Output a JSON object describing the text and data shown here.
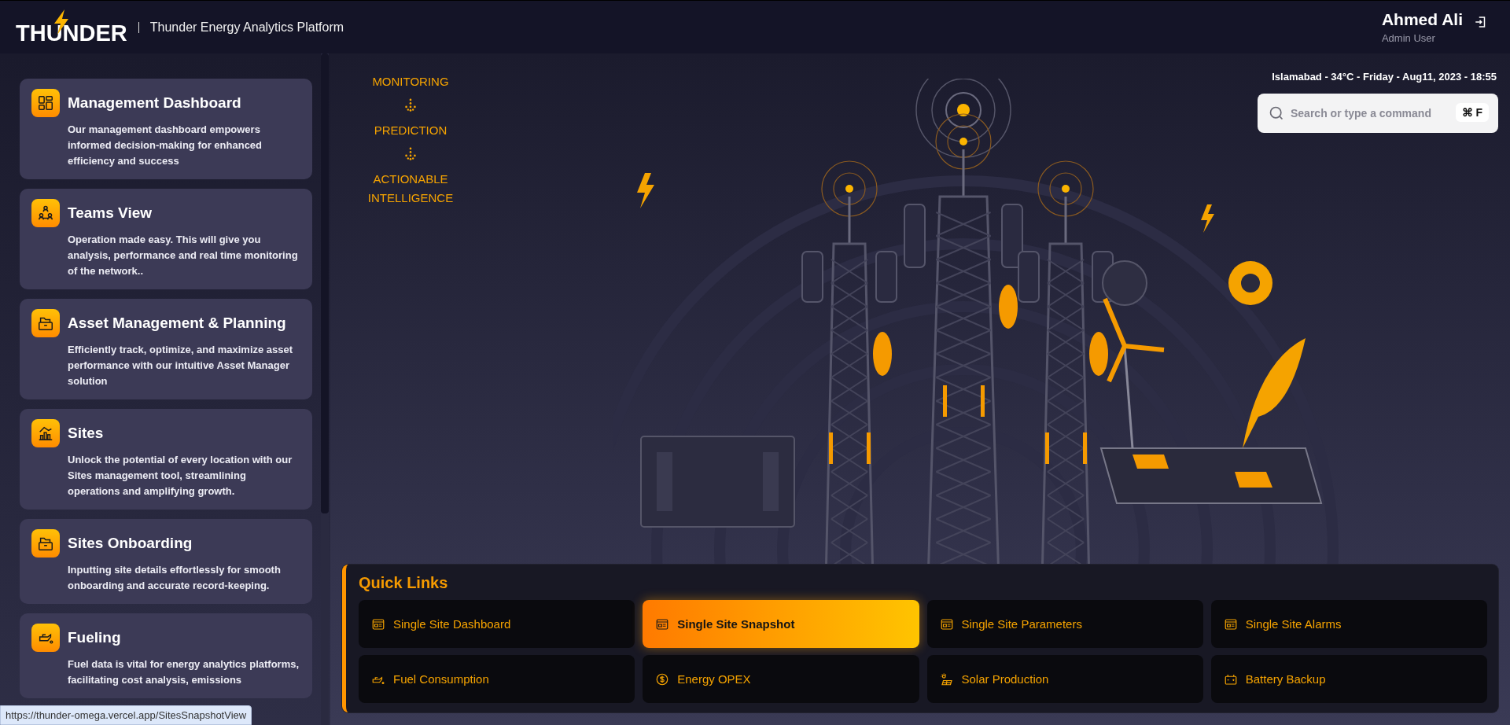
{
  "header": {
    "logo": "THUNDER",
    "platform_title": "Thunder Energy Analytics Platform",
    "user": {
      "name": "Ahmed Ali",
      "role": "Admin User"
    }
  },
  "sidebar": {
    "items": [
      {
        "kind": "dashboard",
        "title": "Management Dashboard",
        "description": "Our management dashboard empowers informed decision-making for enhanced efficiency and success"
      },
      {
        "kind": "team",
        "title": "Teams View",
        "description": "Operation made easy. This will give you analysis, performance and real time monitoring of the network.."
      },
      {
        "kind": "folder",
        "title": "Asset Management & Planning",
        "description": "Efficiently track, optimize, and maximize asset performance with our intuitive Asset Manager solution"
      },
      {
        "kind": "chart",
        "title": "Sites",
        "description": "Unlock the potential of every location with our Sites management tool, streamlining operations and amplifying growth."
      },
      {
        "kind": "folder",
        "title": "Sites Onboarding",
        "description": "Inputting site details effortlessly for smooth onboarding and accurate record-keeping."
      },
      {
        "kind": "oil",
        "title": "Fueling",
        "description": "Fuel data is vital for energy analytics platforms, facilitating cost analysis, emissions"
      }
    ]
  },
  "taglines": [
    "MONITORING",
    "PREDICTION",
    "ACTIONABLE INTELLIGENCE"
  ],
  "status_line": "Islamabad - 34°C - Friday - Aug11, 2023 - 18:55",
  "search": {
    "placeholder": "Search or type a command",
    "shortcut": "⌘ F"
  },
  "quick_links": {
    "title": "Quick Links",
    "items": [
      {
        "kind": "monitor",
        "label": "Single Site Dashboard",
        "selected": false
      },
      {
        "kind": "monitor",
        "label": "Single Site Snapshot",
        "selected": true
      },
      {
        "kind": "monitor",
        "label": "Single Site Parameters",
        "selected": false
      },
      {
        "kind": "monitor",
        "label": "Single Site Alarms",
        "selected": false
      },
      {
        "kind": "fuel",
        "label": "Fuel Consumption",
        "selected": false
      },
      {
        "kind": "dollar",
        "label": "Energy OPEX",
        "selected": false
      },
      {
        "kind": "solar",
        "label": "Solar Production",
        "selected": false
      },
      {
        "kind": "battery",
        "label": "Battery Backup",
        "selected": false
      }
    ]
  },
  "link_preview": "https://thunder-omega.vercel.app/SitesSnapshotView"
}
